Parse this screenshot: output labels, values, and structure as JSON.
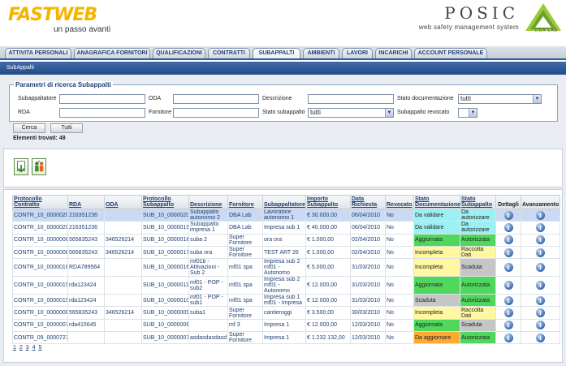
{
  "brand": {
    "left_logo": "FASTWEB",
    "left_tagline": "un passo avanti",
    "right_logo": "POSIC",
    "right_tagline": "web safety management system",
    "dba_label": "DBA LAB"
  },
  "tabs": [
    {
      "label": "ATTIVITA PERSONALI"
    },
    {
      "label": "ANAGRAFICA FORNITORI"
    },
    {
      "label": "QUALIFICAZIONI"
    },
    {
      "label": "CONTRATTI"
    },
    {
      "label": "SUBAPPALTI"
    },
    {
      "label": "AMBIENTI"
    },
    {
      "label": "LAVORI"
    },
    {
      "label": "INCARICHI"
    },
    {
      "label": "ACCOUNT PERSONALE"
    }
  ],
  "active_tab": "SUBAPPALTI",
  "section_title": "SubAppalti",
  "search": {
    "legend": "Parametri di ricerca Subappalti",
    "labels": {
      "subappaltatore": "Subappaltatore",
      "oda": "ODA",
      "descrizione": "Descrizione",
      "stato_documentazione": "Stato documentazione",
      "rda": "RDA",
      "fornitore": "Fornitore",
      "stato_subappalto": "Stato subappalto",
      "subappalto_revocato": "Subappalto revocato"
    },
    "values": {
      "stato_documentazione": "tutti",
      "stato_subappalto": "tutti",
      "subappalto_revocato": ""
    },
    "buttons": {
      "search": "Cerca",
      "all": "Tutti"
    }
  },
  "found": {
    "label": "Elementi trovati:",
    "count": "48"
  },
  "table": {
    "headers": {
      "protocollo_contratto": "Protocollo Contratto",
      "rda": "RDA",
      "oda": "ODA",
      "protocollo_subappalto": "Protocollo Subappalto",
      "descrizione": "Descrizione",
      "fornitore": "Fornitore",
      "subappaltatore": "Subappaltatore",
      "importo": "Importo Subappalto",
      "data": "Data Richiesta",
      "revocato": "Revocato",
      "stato_doc": "Stato Documentazione",
      "stato_sub": "Stato Subappalto",
      "dettagli": "Dettagli",
      "avanzamento": "Avanzamento"
    },
    "rows": [
      {
        "pc": "CONTR_10_0000020",
        "rda": "216351236",
        "oda": "",
        "ps": "SUB_10_0000020",
        "desc": "Subappalto autonomo 2",
        "forn": "DBA Lab",
        "subap": "Lavoratore autonomo 1",
        "imp": "€ 30.000,00",
        "data": "06/04/2010",
        "rev": "No",
        "sd": "Da validare",
        "sd_cls": "st-validare",
        "ss": "Da autorizzare",
        "ss_cls": "st-autorizzare",
        "selected": true
      },
      {
        "pc": "CONTR_10_0000020",
        "rda": "216351236",
        "oda": "",
        "ps": "SUB_10_0000019",
        "desc": "Subappalto impresa 1",
        "forn": "DBA Lab",
        "subap": "Impresa sub 1",
        "imp": "€ 40.000,00",
        "data": "06/04/2010",
        "rev": "No",
        "sd": "Da validare",
        "sd_cls": "st-validare",
        "ss": "Da autorizzare",
        "ss_cls": "st-autorizzare",
        "selected": false
      },
      {
        "pc": "CONTR_10_0000008",
        "rda": "565835243",
        "oda": "346526214",
        "ps": "SUB_10_0000018",
        "desc": "suba 2",
        "forn": "Super Fornitore",
        "subap": "ora ora",
        "imp": "€ 1.000,00",
        "data": "02/04/2010",
        "rev": "No",
        "sd": "Aggiornata",
        "sd_cls": "st-aggiornata",
        "ss": "Autorizzata",
        "ss_cls": "st-autorizzata",
        "selected": false
      },
      {
        "pc": "CONTR_10_0000008",
        "rda": "565835243",
        "oda": "346526214",
        "ps": "SUB_10_0000017",
        "desc": "suba ora",
        "forn": "Super Fornitore",
        "subap": "TEST ART 26",
        "imp": "€ 1.000,00",
        "data": "02/04/2010",
        "rev": "No",
        "sd": "Incompleta",
        "sd_cls": "st-incompleta",
        "ss": "Raccolta Dati",
        "ss_cls": "st-raccolta",
        "selected": false
      },
      {
        "pc": "CONTR_10_0000016",
        "rda": "RDA789564",
        "oda": "",
        "ps": "SUB_10_0000016",
        "desc": "mf01b - Attivazioni - Sub 2",
        "forn": "mf01 spa",
        "subap": "Impresa sub 2 mf01 - Autonomo",
        "imp": "€ 5.000,00",
        "data": "31/03/2010",
        "rev": "No",
        "sd": "Incompleta",
        "sd_cls": "st-incompleta",
        "ss": "Scaduta",
        "ss_cls": "st-scadutas",
        "selected": false
      },
      {
        "pc": "CONTR_10_0000015",
        "rda": "rda123424",
        "oda": "",
        "ps": "SUB_10_0000011",
        "desc": "mf01 - POP - sub2",
        "forn": "mf01 spa",
        "subap": "Impresa sub 2 mf01 - Autonomo",
        "imp": "€ 12.000,00",
        "data": "31/03/2010",
        "rev": "No",
        "sd": "Aggiornata",
        "sd_cls": "st-aggiornata",
        "ss": "Autorizzata",
        "ss_cls": "st-autorizzata",
        "selected": false
      },
      {
        "pc": "CONTR_10_0000015",
        "rda": "rda123424",
        "oda": "",
        "ps": "SUB_10_0000010",
        "desc": "mf01 - POP - sub1",
        "forn": "mf01 spa",
        "subap": "Impresa sub 1 mf01 - Impresa",
        "imp": "€ 12.000,00",
        "data": "31/03/2010",
        "rev": "No",
        "sd": "Scaduta",
        "sd_cls": "st-scaduta",
        "ss": "Autorizzata",
        "ss_cls": "st-autorizzata",
        "selected": false
      },
      {
        "pc": "CONTR_10_0000008",
        "rda": "565835243",
        "oda": "346526214",
        "ps": "SUB_10_0000009",
        "desc": "suba1",
        "forn": "Super Fornitore",
        "subap": "cantieroggi",
        "imp": "€ 3.500,00",
        "data": "30/03/2010",
        "rev": "No",
        "sd": "Incompleta",
        "sd_cls": "st-incompleta",
        "ss": "Raccolta Dati",
        "ss_cls": "st-raccolta",
        "selected": false
      },
      {
        "pc": "CONTR_10_0000007",
        "rda": "rda415645",
        "oda": "",
        "ps": "SUB_10_0000008",
        "desc": "",
        "forn": "mf 3",
        "subap": "Impresa 1",
        "imp": "€ 12.000,00",
        "data": "12/03/2010",
        "rev": "No",
        "sd": "Aggiornata",
        "sd_cls": "st-aggiornata",
        "ss": "Scaduta",
        "ss_cls": "st-scadutas",
        "selected": false
      },
      {
        "pc": "CONTR_09_0000727",
        "rda": "",
        "oda": "",
        "ps": "SUB_10_0000007",
        "desc": "asdasdasdasd",
        "forn": "Super Fornitore",
        "subap": "Impresa 1",
        "imp": "€ 1.232.132,00",
        "data": "12/03/2010",
        "rev": "No",
        "sd": "Da aggiornare",
        "sd_cls": "st-aggiornare",
        "ss": "Autorizzata",
        "ss_cls": "st-autorizzata",
        "selected": false
      }
    ]
  },
  "pager": [
    "1",
    "2",
    "3",
    "4",
    "5"
  ]
}
